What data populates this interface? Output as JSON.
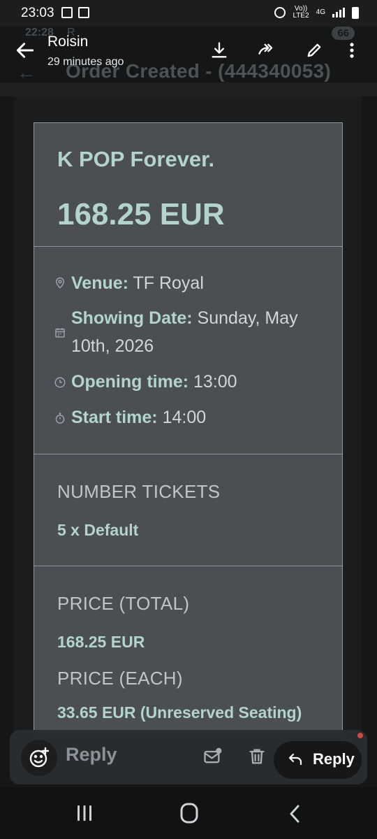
{
  "status_bar": {
    "time": "23:03",
    "net_small_1": "Vo))",
    "net_small_2": "LTE2",
    "net_type": "4G"
  },
  "ghost_bar": {
    "time": "22:28",
    "letter": "R",
    "badge": "66",
    "title": "Order Created - (444340053)"
  },
  "header": {
    "sender": "Roisin",
    "time_ago": "29 minutes ago"
  },
  "card": {
    "event_title": "K POP Forever.",
    "event_price": "168.25 EUR",
    "venue_label": "Venue:",
    "venue_value": " TF Royal",
    "showing_label": "Showing Date:",
    "showing_value": " Sunday, May 10th, 2026",
    "opening_label": "Opening time:",
    "opening_value": " 13:00",
    "start_label": "Start time:",
    "start_value": " 14:00",
    "tickets_heading": "NUMBER TICKETS",
    "tickets_value": "5 x Default",
    "price_total_heading": "PRICE (TOTAL)",
    "price_total_value": "168.25 EUR",
    "price_each_heading": "PRICE (EACH)",
    "price_each_value": "33.65 EUR (Unreserved Seating)"
  },
  "action_bar": {
    "reply_placeholder": "Reply",
    "reply_button": "Reply"
  },
  "colors": {
    "accent_text": "#b2d4cc",
    "card_bg": "#4b4e52",
    "app_bg": "#141618"
  }
}
